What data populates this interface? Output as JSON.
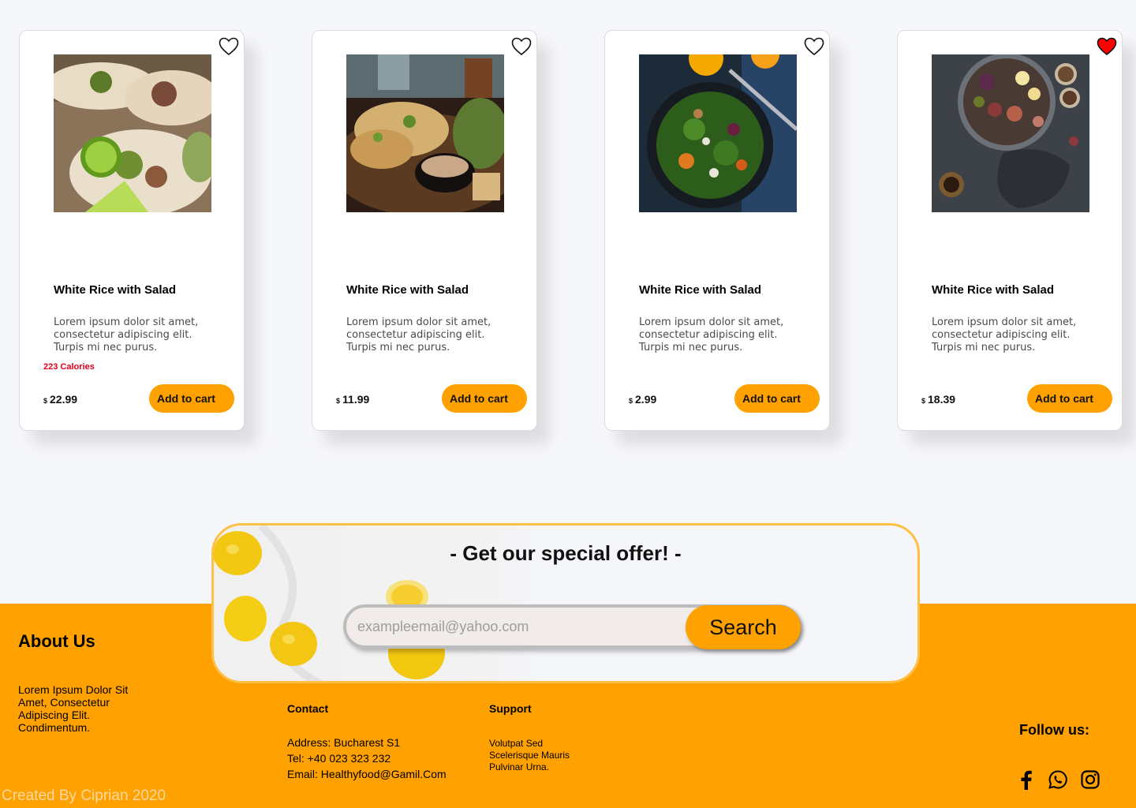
{
  "colors": {
    "accent": "#ffa100",
    "offer_border": "#ffbf45",
    "calories": "#e3001b",
    "heart_active": "#ff0000",
    "page_bg": "#f6f7fb"
  },
  "cards": [
    {
      "title": "White Rice with Salad",
      "description": "Lorem ipsum dolor sit amet, consectetur adipiscing elit. Turpis mi nec purus.",
      "calories": "223  Calories",
      "currency": "$",
      "price": "22.99",
      "cart_label": "Add to cart",
      "favorite": false,
      "image": "tacos-photo"
    },
    {
      "title": "White Rice with Salad",
      "description": "Lorem ipsum dolor sit amet, consectetur adipiscing elit. Turpis mi nec purus.",
      "calories": "",
      "currency": "$",
      "price": "11.99",
      "cart_label": "Add to cart",
      "favorite": false,
      "image": "grilled-chicken-photo"
    },
    {
      "title": "White Rice with Salad",
      "description": "Lorem ipsum dolor sit amet, consectetur adipiscing elit. Turpis mi nec purus.",
      "calories": "",
      "currency": "$",
      "price": "2.99",
      "cart_label": "Add to cart",
      "favorite": false,
      "image": "salad-bowl-photo"
    },
    {
      "title": "White Rice with Salad",
      "description": "Lorem ipsum dolor sit amet, consectetur adipiscing elit. Turpis mi nec purus.",
      "calories": "",
      "currency": "$",
      "price": "18.39",
      "cart_label": "Add to cart",
      "favorite": true,
      "image": "figs-platter-photo"
    }
  ],
  "offer": {
    "title": "- Get our special offer! -",
    "email_placeholder": "exampleemail@yahoo.com",
    "search_label": "Search"
  },
  "footer": {
    "about_title": "About Us",
    "about_text": "Lorem Ipsum Dolor Sit Amet, Consectetur Adipiscing Elit. Condimentum.",
    "contact_title": "Contact",
    "contact_address": "Address: Bucharest S1",
    "contact_tel": "Tel: +40 023 323 232",
    "contact_email": "Email: Healthyfood@Gamil.Com",
    "support_title": "Support",
    "support_text": "Volutpat Sed Scelerisque Mauris Pulvinar Urna.",
    "follow_label": "Follow us:",
    "social_icons": [
      "facebook-icon",
      "whatsapp-icon",
      "instagram-icon"
    ],
    "credit": "Created By Ciprian 2020"
  }
}
